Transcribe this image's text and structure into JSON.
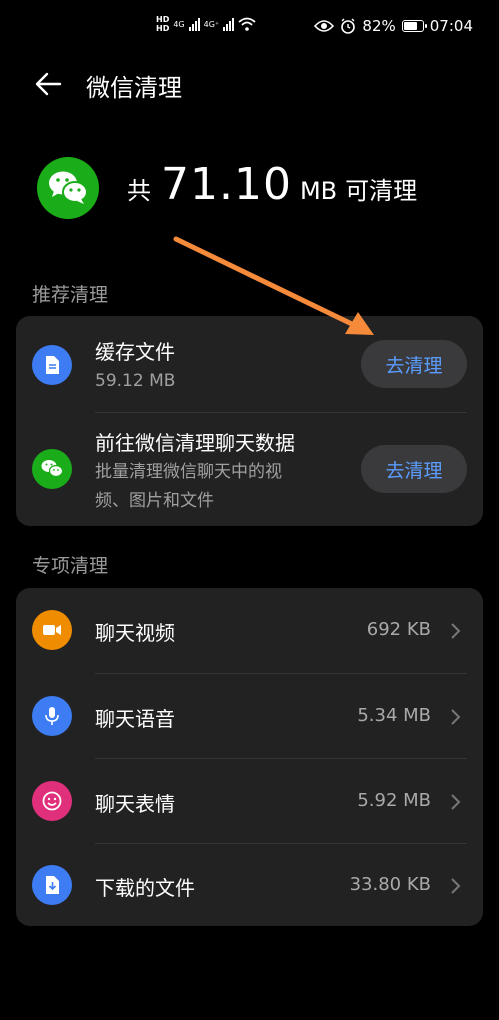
{
  "status": {
    "network_left": "HD 4G",
    "network_right": "4G⁺",
    "battery": "82%",
    "battery_level": 0.82,
    "time": "07:04"
  },
  "header": {
    "title": "微信清理"
  },
  "summary": {
    "prefix": "共",
    "amount": "71.10",
    "unit": "MB",
    "suffix": "可清理"
  },
  "recommended": {
    "label": "推荐清理",
    "items": [
      {
        "title": "缓存文件",
        "subtitle": "59.12 MB",
        "button": "去清理",
        "icon": "document-icon"
      },
      {
        "title": "前往微信清理聊天数据",
        "subtitle_line1": "批量清理微信聊天中的视",
        "subtitle_line2": "频、图片和文件",
        "button": "去清理",
        "icon": "wechat-icon"
      }
    ]
  },
  "special": {
    "label": "专项清理",
    "items": [
      {
        "title": "聊天视频",
        "value": "692 KB",
        "icon": "video-icon",
        "color": "#f08c00"
      },
      {
        "title": "聊天语音",
        "value": "5.34 MB",
        "icon": "microphone-icon",
        "color": "#3d7cf2"
      },
      {
        "title": "聊天表情",
        "value": "5.92 MB",
        "icon": "smiley-icon",
        "color": "#e0307c"
      },
      {
        "title": "下载的文件",
        "value": "33.80 KB",
        "icon": "download-file-icon",
        "color": "#3d7cf2"
      }
    ]
  },
  "colors": {
    "accent": "#5b9cff",
    "wechat": "#1aad19",
    "annotation_arrow": "#f58a3a"
  }
}
